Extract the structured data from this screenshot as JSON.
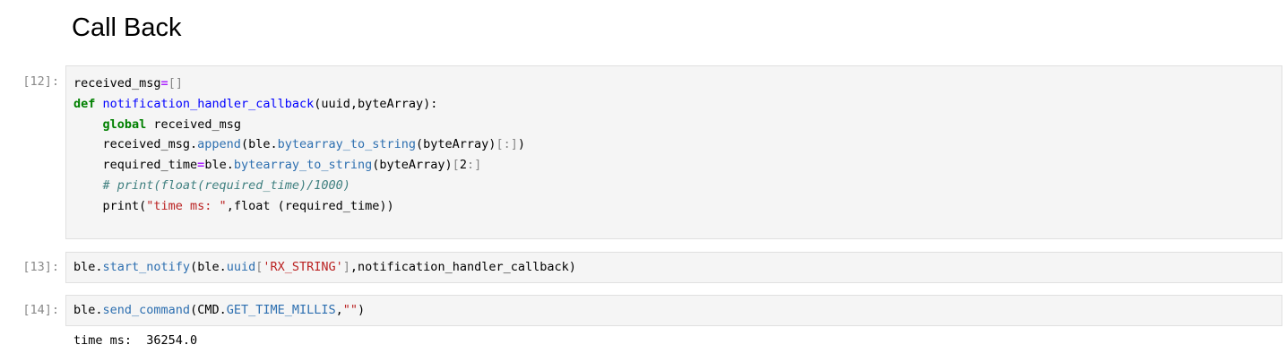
{
  "heading": "Call Back",
  "cells": [
    {
      "prompt": "[12]:",
      "lines": [
        [
          {
            "t": "received_msg",
            "c": "nb"
          },
          {
            "t": "=",
            "c": "op"
          },
          {
            "t": "[]",
            "c": "br"
          }
        ],
        [
          {
            "t": "def",
            "c": "kw"
          },
          {
            "t": " ",
            "c": "nb"
          },
          {
            "t": "notification_handler_callback",
            "c": "fn"
          },
          {
            "t": "(uuid,byteArray):",
            "c": "nb"
          }
        ],
        [
          {
            "t": "    ",
            "c": "nb"
          },
          {
            "t": "global",
            "c": "kw"
          },
          {
            "t": " received_msg",
            "c": "nb"
          }
        ],
        [
          {
            "t": "    received_msg.",
            "c": "nb"
          },
          {
            "t": "append",
            "c": "at"
          },
          {
            "t": "(ble.",
            "c": "nb"
          },
          {
            "t": "bytearray_to_string",
            "c": "at"
          },
          {
            "t": "(byteArray)",
            "c": "nb"
          },
          {
            "t": "[:]",
            "c": "br"
          },
          {
            "t": ")",
            "c": "nb"
          }
        ],
        [
          {
            "t": "    required_time",
            "c": "nb"
          },
          {
            "t": "=",
            "c": "op"
          },
          {
            "t": "ble.",
            "c": "nb"
          },
          {
            "t": "bytearray_to_string",
            "c": "at"
          },
          {
            "t": "(byteArray)",
            "c": "nb"
          },
          {
            "t": "[",
            "c": "br"
          },
          {
            "t": "2",
            "c": "nb"
          },
          {
            "t": ":]",
            "c": "br"
          }
        ],
        [
          {
            "t": "    ",
            "c": "nb"
          },
          {
            "t": "# print(float(required_time)/1000)",
            "c": "cm"
          }
        ],
        [
          {
            "t": "    print(",
            "c": "nb"
          },
          {
            "t": "\"time ms: \"",
            "c": "st"
          },
          {
            "t": ",float (required_time))",
            "c": "nb"
          }
        ],
        [
          {
            "t": " ",
            "c": "nb"
          }
        ]
      ],
      "output": ""
    },
    {
      "prompt": "[13]:",
      "lines": [
        [
          {
            "t": "ble.",
            "c": "nb"
          },
          {
            "t": "start_notify",
            "c": "at"
          },
          {
            "t": "(ble.",
            "c": "nb"
          },
          {
            "t": "uuid",
            "c": "at"
          },
          {
            "t": "[",
            "c": "br"
          },
          {
            "t": "'RX_STRING'",
            "c": "st"
          },
          {
            "t": "]",
            "c": "br"
          },
          {
            "t": ",notification_handler_callback)",
            "c": "nb"
          }
        ]
      ],
      "output": ""
    },
    {
      "prompt": "[14]:",
      "lines": [
        [
          {
            "t": "ble.",
            "c": "nb"
          },
          {
            "t": "send_command",
            "c": "at"
          },
          {
            "t": "(CMD.",
            "c": "nb"
          },
          {
            "t": "GET_TIME_MILLIS",
            "c": "at"
          },
          {
            "t": ",",
            "c": "nb"
          },
          {
            "t": "\"\"",
            "c": "st"
          },
          {
            "t": ")",
            "c": "nb"
          }
        ]
      ],
      "output": "time ms:  36254.0"
    }
  ],
  "colors": {
    "keyword": "#008000",
    "function": "#0000ff",
    "attribute": "#2d6fb0",
    "operator": "#aa22ff",
    "bracket": "#888888",
    "string": "#ba2121",
    "comment": "#408080",
    "prompt": "#8a8a8a",
    "cell_background": "#f5f5f5"
  }
}
